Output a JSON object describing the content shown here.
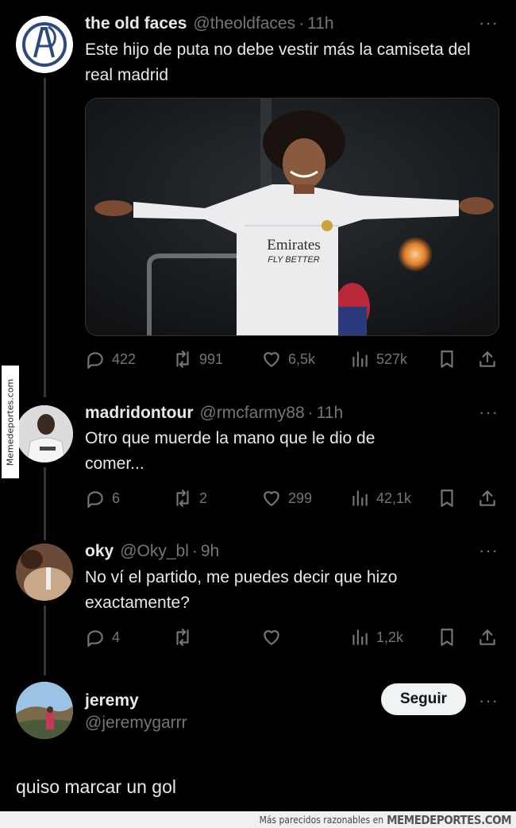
{
  "tweets": [
    {
      "name": "the old faces",
      "handle": "@theoldfaces",
      "time": "11h",
      "text": "Este hijo de puta no debe vestir más la camiseta del real madrid",
      "replies": "422",
      "retweets": "991",
      "likes": "6,5k",
      "views": "527k"
    },
    {
      "name": "madridontour",
      "handle": "@rmcfarmy88",
      "time": "11h",
      "text": "Otro que muerde la mano que le dio de comer...",
      "replies": "6",
      "retweets": "2",
      "likes": "299",
      "views": "42,1k"
    },
    {
      "name": "oky",
      "handle": "@Oky_bl",
      "time": "9h",
      "text": "No ví el partido, me puedes decir que hizo exactamente?",
      "replies": "4",
      "retweets": "",
      "likes": "",
      "views": "1,2k"
    }
  ],
  "profile": {
    "name": "jeremy",
    "handle": "@jeremygarrr",
    "follow_label": "Seguir",
    "reply_text": "quiso marcar un gol"
  },
  "media": {
    "shirt_sponsor": "Emirates",
    "shirt_sub": "FLY BETTER"
  },
  "watermark": {
    "side": "Memedeportes.com",
    "footer_prefix": "Más parecidos razonables en",
    "footer_brand": "MEMEDEPORTES.COM"
  },
  "separator": "·",
  "more_glyph": "···",
  "colors": {
    "background": "#000000",
    "text": "#e7e9ea",
    "muted": "#71767b",
    "button": "#eff3f4"
  }
}
